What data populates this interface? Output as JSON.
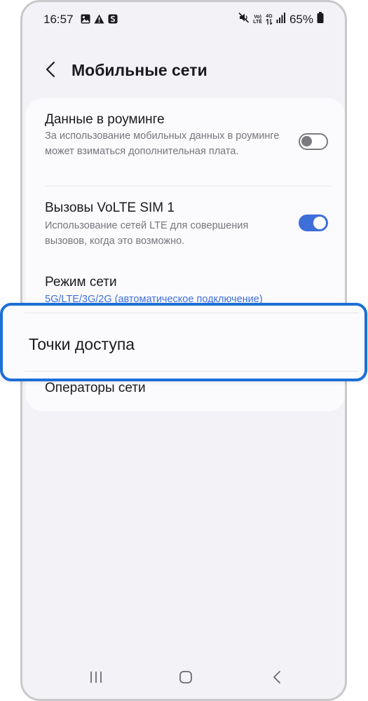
{
  "status_bar": {
    "time": "16:57",
    "left_icons": [
      "gallery-icon",
      "warning-icon",
      "samsung-s-icon"
    ],
    "right_icons": [
      "mute-icon",
      "volte-icon",
      "4g-data-icon",
      "signal-icon",
      "battery-icon"
    ],
    "volte_label_top": "Vo)",
    "volte_label_bottom": "LTE",
    "net_label": "4G",
    "battery": "65%"
  },
  "header": {
    "back_icon": "chevron-left-icon",
    "title": "Мобильные сети"
  },
  "settings": {
    "roaming": {
      "title": "Данные в роуминге",
      "description": "За использование мобильных данных в роуминге может взиматься дополнительная плата.",
      "enabled": false
    },
    "volte": {
      "title": "Вызовы VoLTE SIM 1",
      "description": "Использование сетей LTE для совершения вызовов, когда это возможно.",
      "enabled": true
    },
    "network_mode": {
      "title": "Режим сети",
      "value": "5G/LTE/3G/2G (автоматическое подключение)"
    },
    "access_points": {
      "title": "Точки доступа"
    },
    "operators": {
      "title": "Операторы сети"
    }
  },
  "colors": {
    "accent": "#3e6fd8",
    "highlight_border": "#1c6fd6",
    "background": "#f3f3f7",
    "card": "#fbfbfe"
  },
  "nav_bar": {
    "recents_icon": "recents-icon",
    "home_icon": "home-icon",
    "back_icon": "back-icon"
  }
}
